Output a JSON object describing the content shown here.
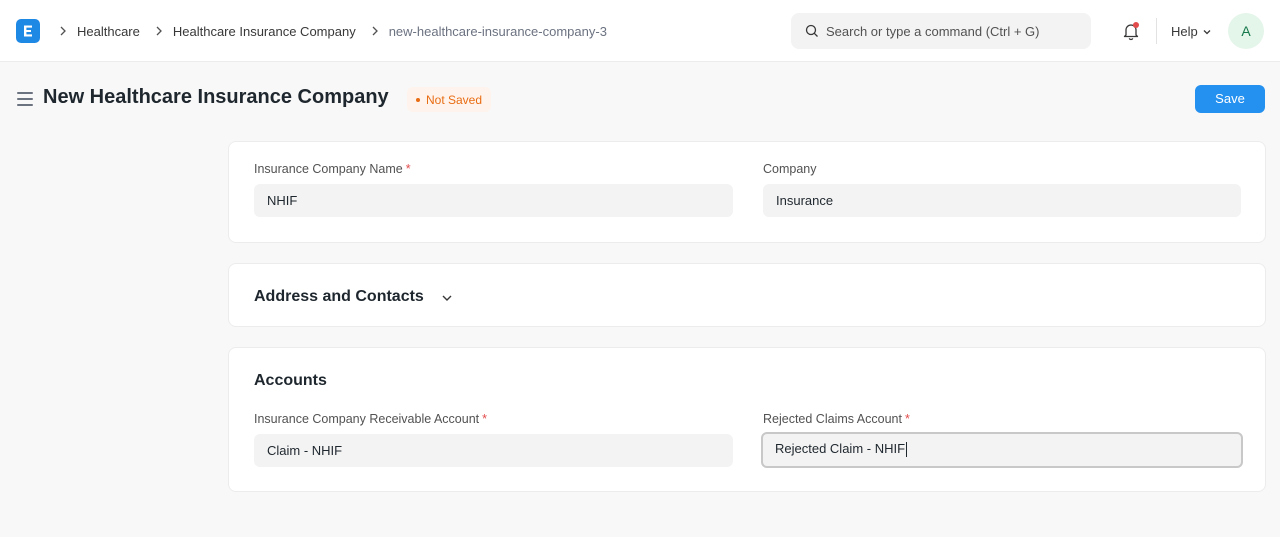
{
  "navbar": {
    "logo_letter": "E",
    "breadcrumbs": [
      {
        "label": "Healthcare"
      },
      {
        "label": "Healthcare Insurance Company"
      },
      {
        "label": "new-healthcare-insurance-company-3"
      }
    ],
    "search_placeholder": "Search or type a command (Ctrl + G)",
    "help_label": "Help",
    "avatar_initial": "A"
  },
  "page": {
    "title": "New Healthcare Insurance Company",
    "status": "Not Saved",
    "save_label": "Save"
  },
  "details": {
    "insurance_company_name": {
      "label": "Insurance Company Name",
      "required": "*",
      "value": "NHIF"
    },
    "company": {
      "label": "Company",
      "value": "Insurance"
    }
  },
  "address_section": {
    "title": "Address and Contacts",
    "collapsed": true
  },
  "accounts_section": {
    "title": "Accounts",
    "receivable_account": {
      "label": "Insurance Company Receivable Account",
      "required": "*",
      "value": "Claim - NHIF"
    },
    "rejected_claims_account": {
      "label": "Rejected Claims Account",
      "required": "*",
      "value": "Rejected Claim - NHIF"
    }
  },
  "colors": {
    "primary": "#2490ef",
    "status_orange": "#e86c13",
    "required_red": "#e24c4c",
    "avatar_bg": "#e4f5e9",
    "avatar_fg": "#16794c"
  },
  "icons": [
    "app-logo-icon",
    "chevron-right-icon",
    "search-icon",
    "bell-icon",
    "chevron-down-icon",
    "hamburger-icon"
  ]
}
